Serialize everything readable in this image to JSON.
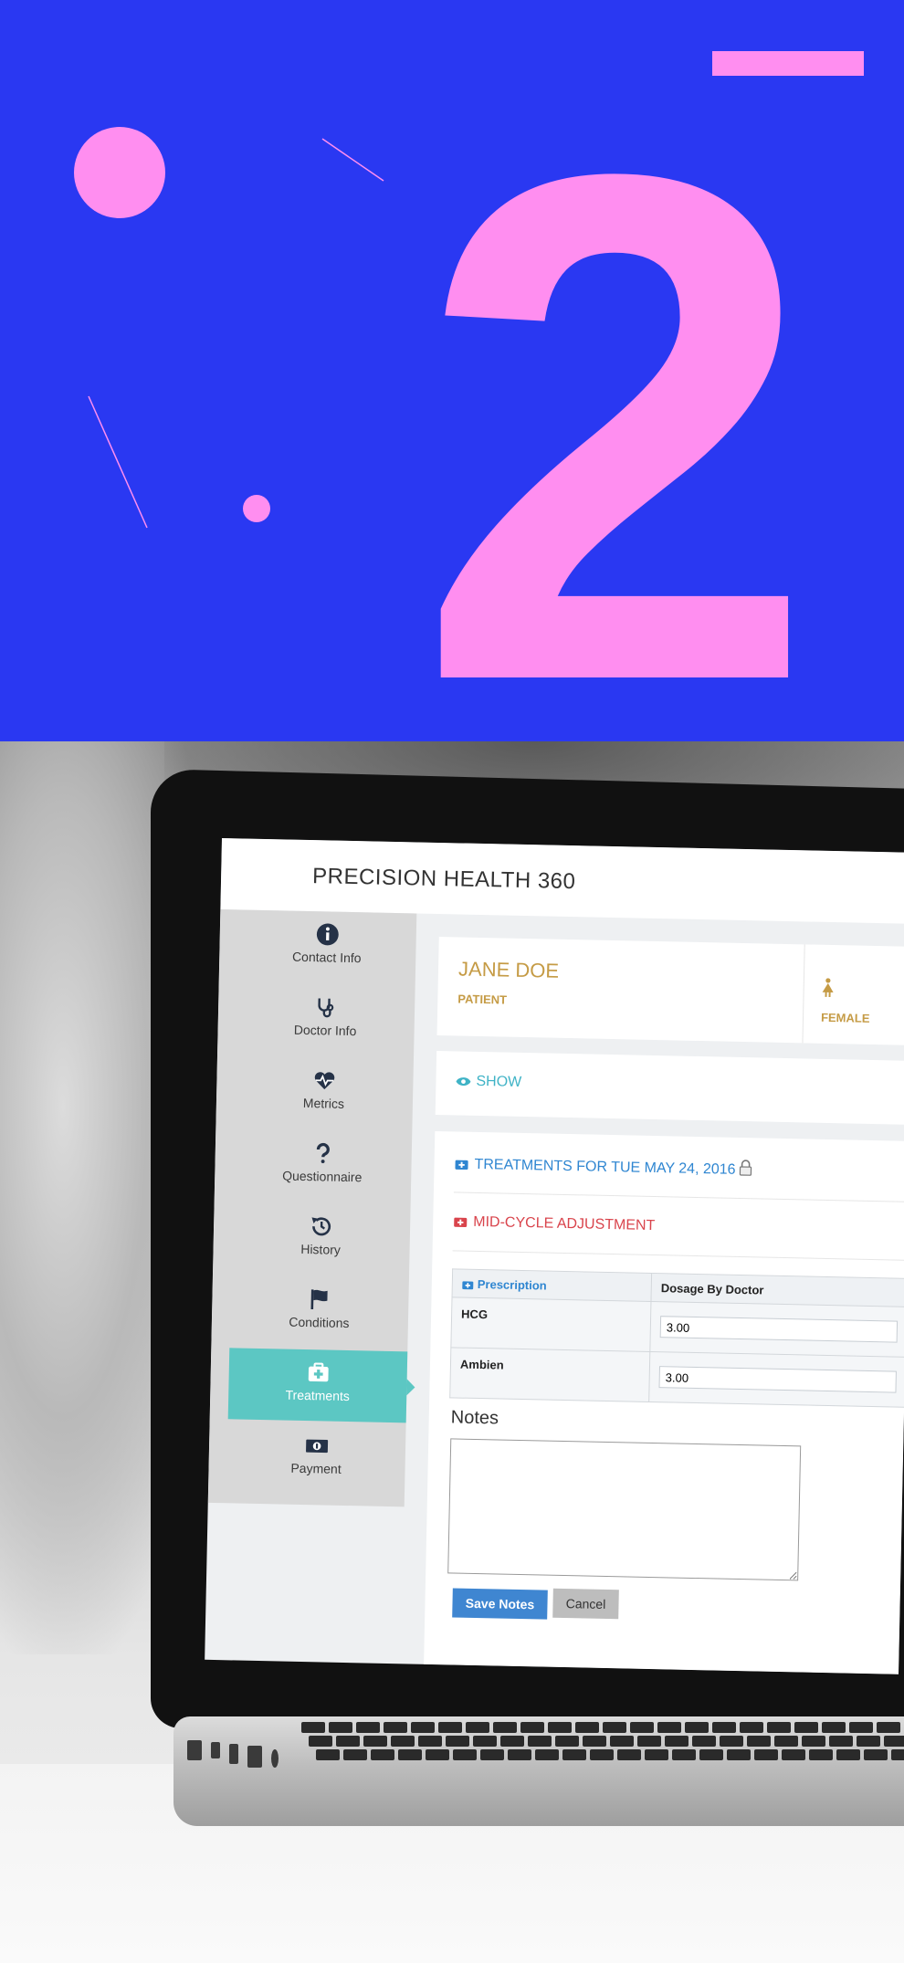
{
  "hero": {
    "numeral": "2",
    "colors": {
      "background": "#2a38f2",
      "accent": "#ff8ef0"
    }
  },
  "app": {
    "title": "PRECISION HEALTH 360",
    "sidebar": {
      "items": [
        {
          "label": "Contact Info",
          "icon": "info-circle-icon"
        },
        {
          "label": "Doctor Info",
          "icon": "stethoscope-icon"
        },
        {
          "label": "Metrics",
          "icon": "heartbeat-icon"
        },
        {
          "label": "Questionnaire",
          "icon": "question-icon"
        },
        {
          "label": "History",
          "icon": "history-icon"
        },
        {
          "label": "Conditions",
          "icon": "flag-icon"
        },
        {
          "label": "Treatments",
          "icon": "medkit-icon",
          "active": true
        },
        {
          "label": "Payment",
          "icon": "money-icon"
        }
      ]
    },
    "patient": {
      "name": "JANE DOE",
      "role": "PATIENT",
      "gender": "FEMALE"
    },
    "show_label": "SHOW",
    "treatments": {
      "title": "TREATMENTS FOR TUE MAY 24, 2016",
      "adjustment": "MID-CYCLE ADJUSTMENT",
      "table": {
        "headers": [
          "Prescription",
          "Dosage By Doctor"
        ],
        "rows": [
          {
            "drug": "HCG",
            "dosage": "3.00"
          },
          {
            "drug": "Ambien",
            "dosage": "3.00"
          }
        ]
      },
      "notes_label": "Notes",
      "save_label": "Save Notes",
      "cancel_label": "Cancel"
    },
    "colors": {
      "gold": "#c59b45",
      "teal": "#5cc7c3",
      "blue": "#2f86d1",
      "red": "#d9444c",
      "show": "#3fb3c6"
    }
  }
}
